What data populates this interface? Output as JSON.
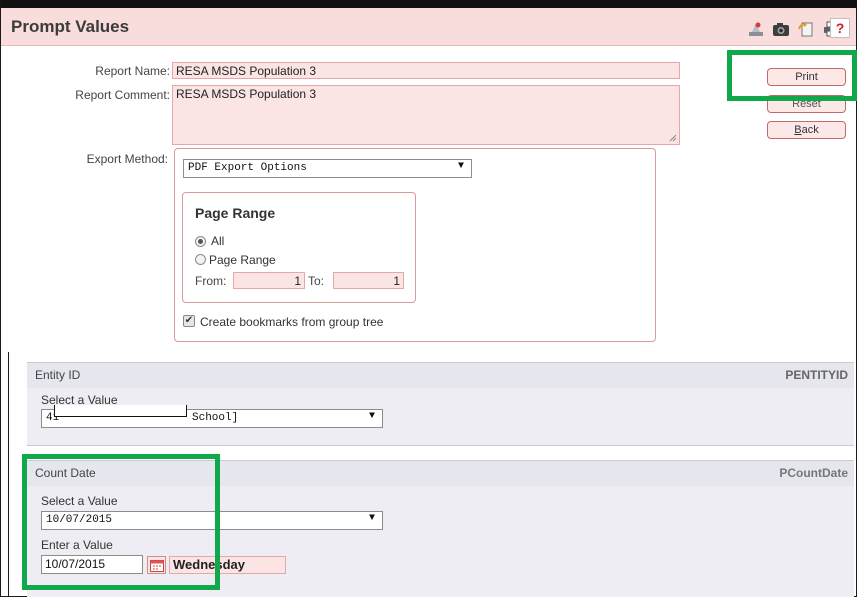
{
  "header": {
    "title": "Prompt Values",
    "tools": [
      "map-pin-icon",
      "camera-icon",
      "document-icon",
      "printer-icon",
      "help-icon"
    ],
    "help_label": "?"
  },
  "report": {
    "name_label": "Report Name:",
    "name_value": "RESA MSDS Population 3",
    "comment_label": "Report Comment:",
    "comment_value": "RESA MSDS Population 3"
  },
  "buttons": {
    "print": "Print",
    "reset": "Reset",
    "back": "Back",
    "back_accesskey": "B"
  },
  "export": {
    "label": "Export Method:",
    "selected": "PDF Export Options",
    "page_range_title": "Page Range",
    "radio_all": "All",
    "radio_page_range": "Page Range",
    "from_label": "From:",
    "from_value": "1",
    "to_label": "To:",
    "to_value": "1",
    "bookmarks_label": "Create bookmarks from group tree"
  },
  "entity": {
    "title": "Entity ID",
    "param": "PENTITYID",
    "select_label": "Select a Value",
    "selected_visible": "41",
    "selected_suffix": "School]"
  },
  "count_date": {
    "title": "Count Date",
    "param": "PCountDate",
    "select_label": "Select a Value",
    "selected": "10/07/2015",
    "enter_label": "Enter a Value",
    "entered": "10/07/2015",
    "weekday": "Wednesday"
  },
  "colors": {
    "accent_pink": "#f9dcdc",
    "highlight_green": "#10a84a"
  }
}
